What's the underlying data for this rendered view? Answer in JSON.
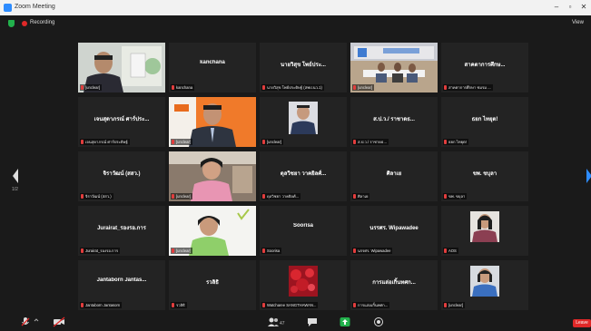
{
  "window": {
    "title": "Zoom Meeting",
    "minimize": "–",
    "maximize": "▫",
    "close": "✕"
  },
  "topbar": {
    "recording_label": "Recording",
    "view_label": "View"
  },
  "gallery": {
    "page_indicator": "1/2",
    "tiles": [
      {
        "display": "",
        "label": "[unclear]",
        "has_video": true
      },
      {
        "display": "kanchana",
        "label": "kanchana",
        "has_video": false
      },
      {
        "display": "นายวิสุข โพธ์ประ...",
        "label": "นายวิสุข โพธ์ประดิษฐ์ (สพป.นว.1)",
        "has_video": false
      },
      {
        "display": "",
        "label": "[unclear]",
        "has_video": true
      },
      {
        "display": "สาคตาการศึกษ...",
        "label": "สาคตาการศึกษา ชมรม ...",
        "has_video": false
      },
      {
        "display": "เจนสุดาภรณ์ ศาร์ประ...",
        "label": "เจนสุดาภรณ์ ศาร์ประดิษฐ์",
        "has_video": false
      },
      {
        "display": "",
        "label": "[unclear]",
        "has_video": true
      },
      {
        "display": "",
        "label": "[unclear]",
        "has_video": true
      },
      {
        "display": "ส.ป.ว./ ราชาดธ...",
        "label": "ส.ป.ว./ ราชาดธ...",
        "has_video": false
      },
      {
        "display": "ธยก ไทยุต!",
        "label": "ธยก ไทยุต!",
        "has_video": false
      },
      {
        "display": "จิราวัฒน์ (สสว.)",
        "label": "จิราวัฒน์ (สสว.)",
        "has_video": false
      },
      {
        "display": "",
        "label": "[unclear]",
        "has_video": true
      },
      {
        "display": "ดุลวิชยา วาคยิลศ์...",
        "label": "ดุลวิชยา วาคยิลศ์...",
        "has_video": false
      },
      {
        "display": "ศิลาเย",
        "label": "ศิลาเย",
        "has_video": false
      },
      {
        "display": "ขพ. ขบุลา",
        "label": "ขพ. ขบุลา",
        "has_video": false
      },
      {
        "display": "Jurairat_รองรอ.การ",
        "label": "Jurairat_รองรอ.การ",
        "has_video": false
      },
      {
        "display": "",
        "label": "[unclear]",
        "has_video": true
      },
      {
        "display": "Soorisa",
        "label": "Soorisa",
        "has_video": false
      },
      {
        "display": "นรรศร. Wipawadee",
        "label": "นรรศร. Wipawadee",
        "has_video": false
      },
      {
        "display": "",
        "label": "AOS",
        "has_video": true
      },
      {
        "display": "Jantaborn Jantas...",
        "label": "Jantaborn Jantasorn",
        "has_video": false
      },
      {
        "display": "รวลิธิ",
        "label": "รวลิธิ",
        "has_video": false
      },
      {
        "display": "",
        "label": "Watcharee SANGTHAWAN...",
        "has_video": true
      },
      {
        "display": "การแล่อเกิ้นทศก...",
        "label": "การแล่อเกิ้นทศก...",
        "has_video": false
      },
      {
        "display": "",
        "label": "[unclear]",
        "has_video": true
      }
    ]
  },
  "toolbar": {
    "participants_count": "47",
    "end_label": "Leave"
  },
  "colors": {
    "background": "#1a1a1a",
    "tile": "#232323",
    "active_speaker": "#c8e632",
    "mic_muted": "#e23d3d",
    "end": "#e02828"
  }
}
